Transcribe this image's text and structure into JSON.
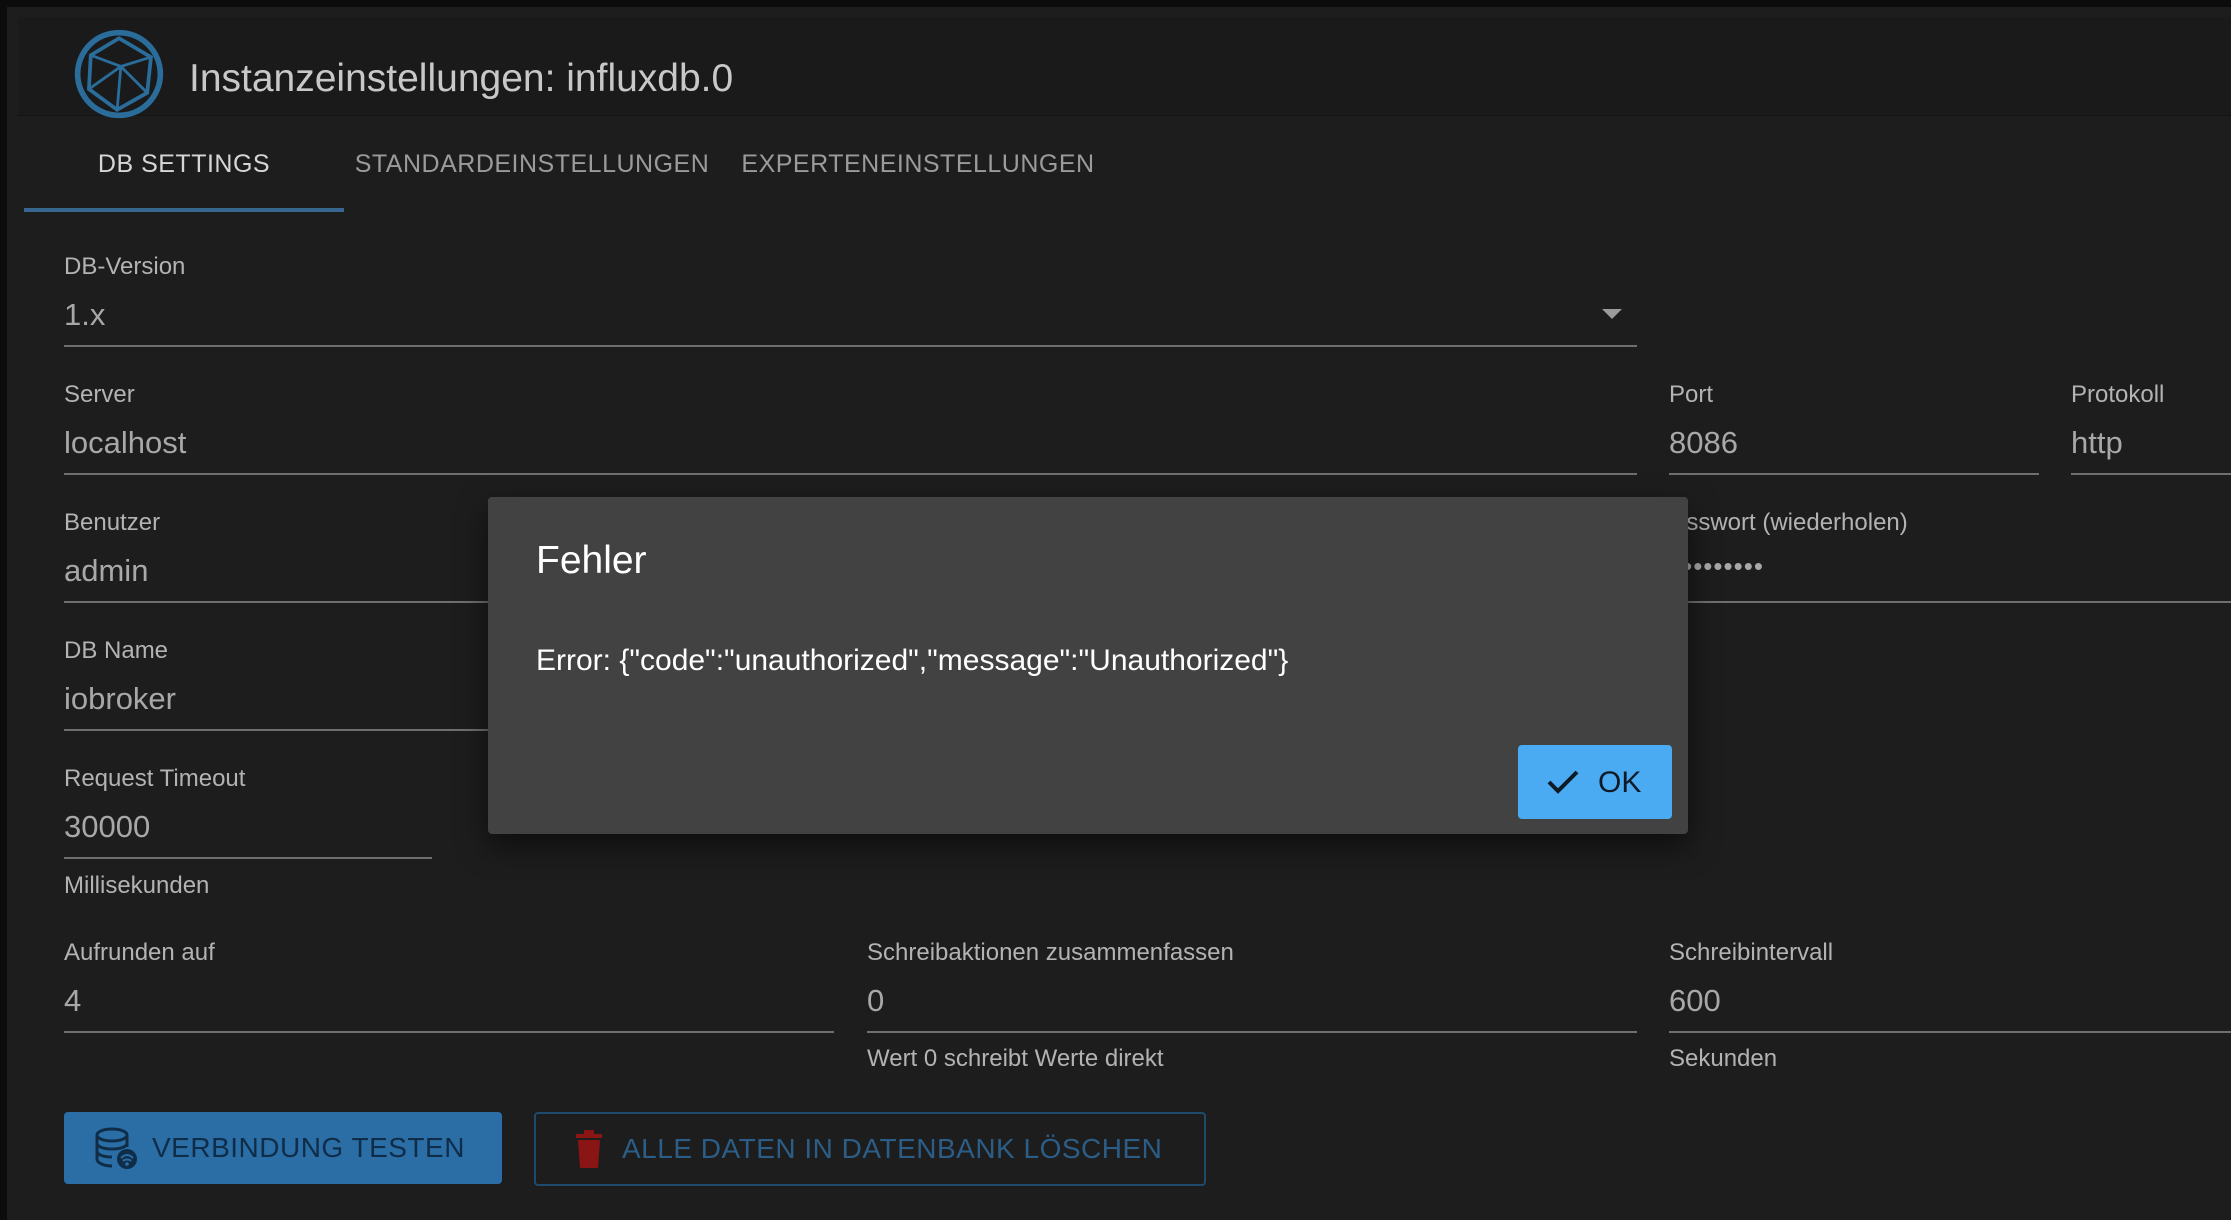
{
  "header": {
    "title": "Instanzeinstellungen: influxdb.0",
    "logo_icon": "iobroker-logo-icon"
  },
  "tabs": [
    {
      "label": "DB SETTINGS",
      "active": true
    },
    {
      "label": "STANDARDEINSTELLUNGEN",
      "active": false
    },
    {
      "label": "EXPERTENEINSTELLUNGEN",
      "active": false
    }
  ],
  "form": {
    "db_version": {
      "label": "DB-Version",
      "value": "1.x"
    },
    "server": {
      "label": "Server",
      "value": "localhost"
    },
    "port": {
      "label": "Port",
      "value": "8086"
    },
    "protocol": {
      "label": "Protokoll",
      "value": "http"
    },
    "user": {
      "label": "Benutzer",
      "value": "admin"
    },
    "password_repeat": {
      "label": "asswort (wiederholen)",
      "value": "•••••••••"
    },
    "db_name": {
      "label": "DB Name",
      "value": "iobroker"
    },
    "request_timeout": {
      "label": "Request Timeout",
      "value": "30000",
      "helper": "Millisekunden"
    },
    "round_to": {
      "label": "Aufrunden auf",
      "value": "4"
    },
    "batch_writes": {
      "label": "Schreibaktionen zusammenfassen",
      "value": "0",
      "helper": "Wert 0 schreibt Werte direkt"
    },
    "write_interval": {
      "label": "Schreibintervall",
      "value": "600",
      "helper": "Sekunden"
    }
  },
  "buttons": {
    "test_connection": "VERBINDUNG TESTEN",
    "delete_all": "ALLE DATEN IN DATENBANK LÖSCHEN"
  },
  "dialog": {
    "title": "Fehler",
    "message": "Error: {\"code\":\"unauthorized\",\"message\":\"Unauthorized\"}",
    "ok_label": "OK"
  },
  "colors": {
    "accent": "#4aaaf2",
    "primary_button": "#2b6ea5",
    "delete_icon": "#8a1515",
    "background": "#1d1d1d",
    "dialog": "#424242"
  }
}
